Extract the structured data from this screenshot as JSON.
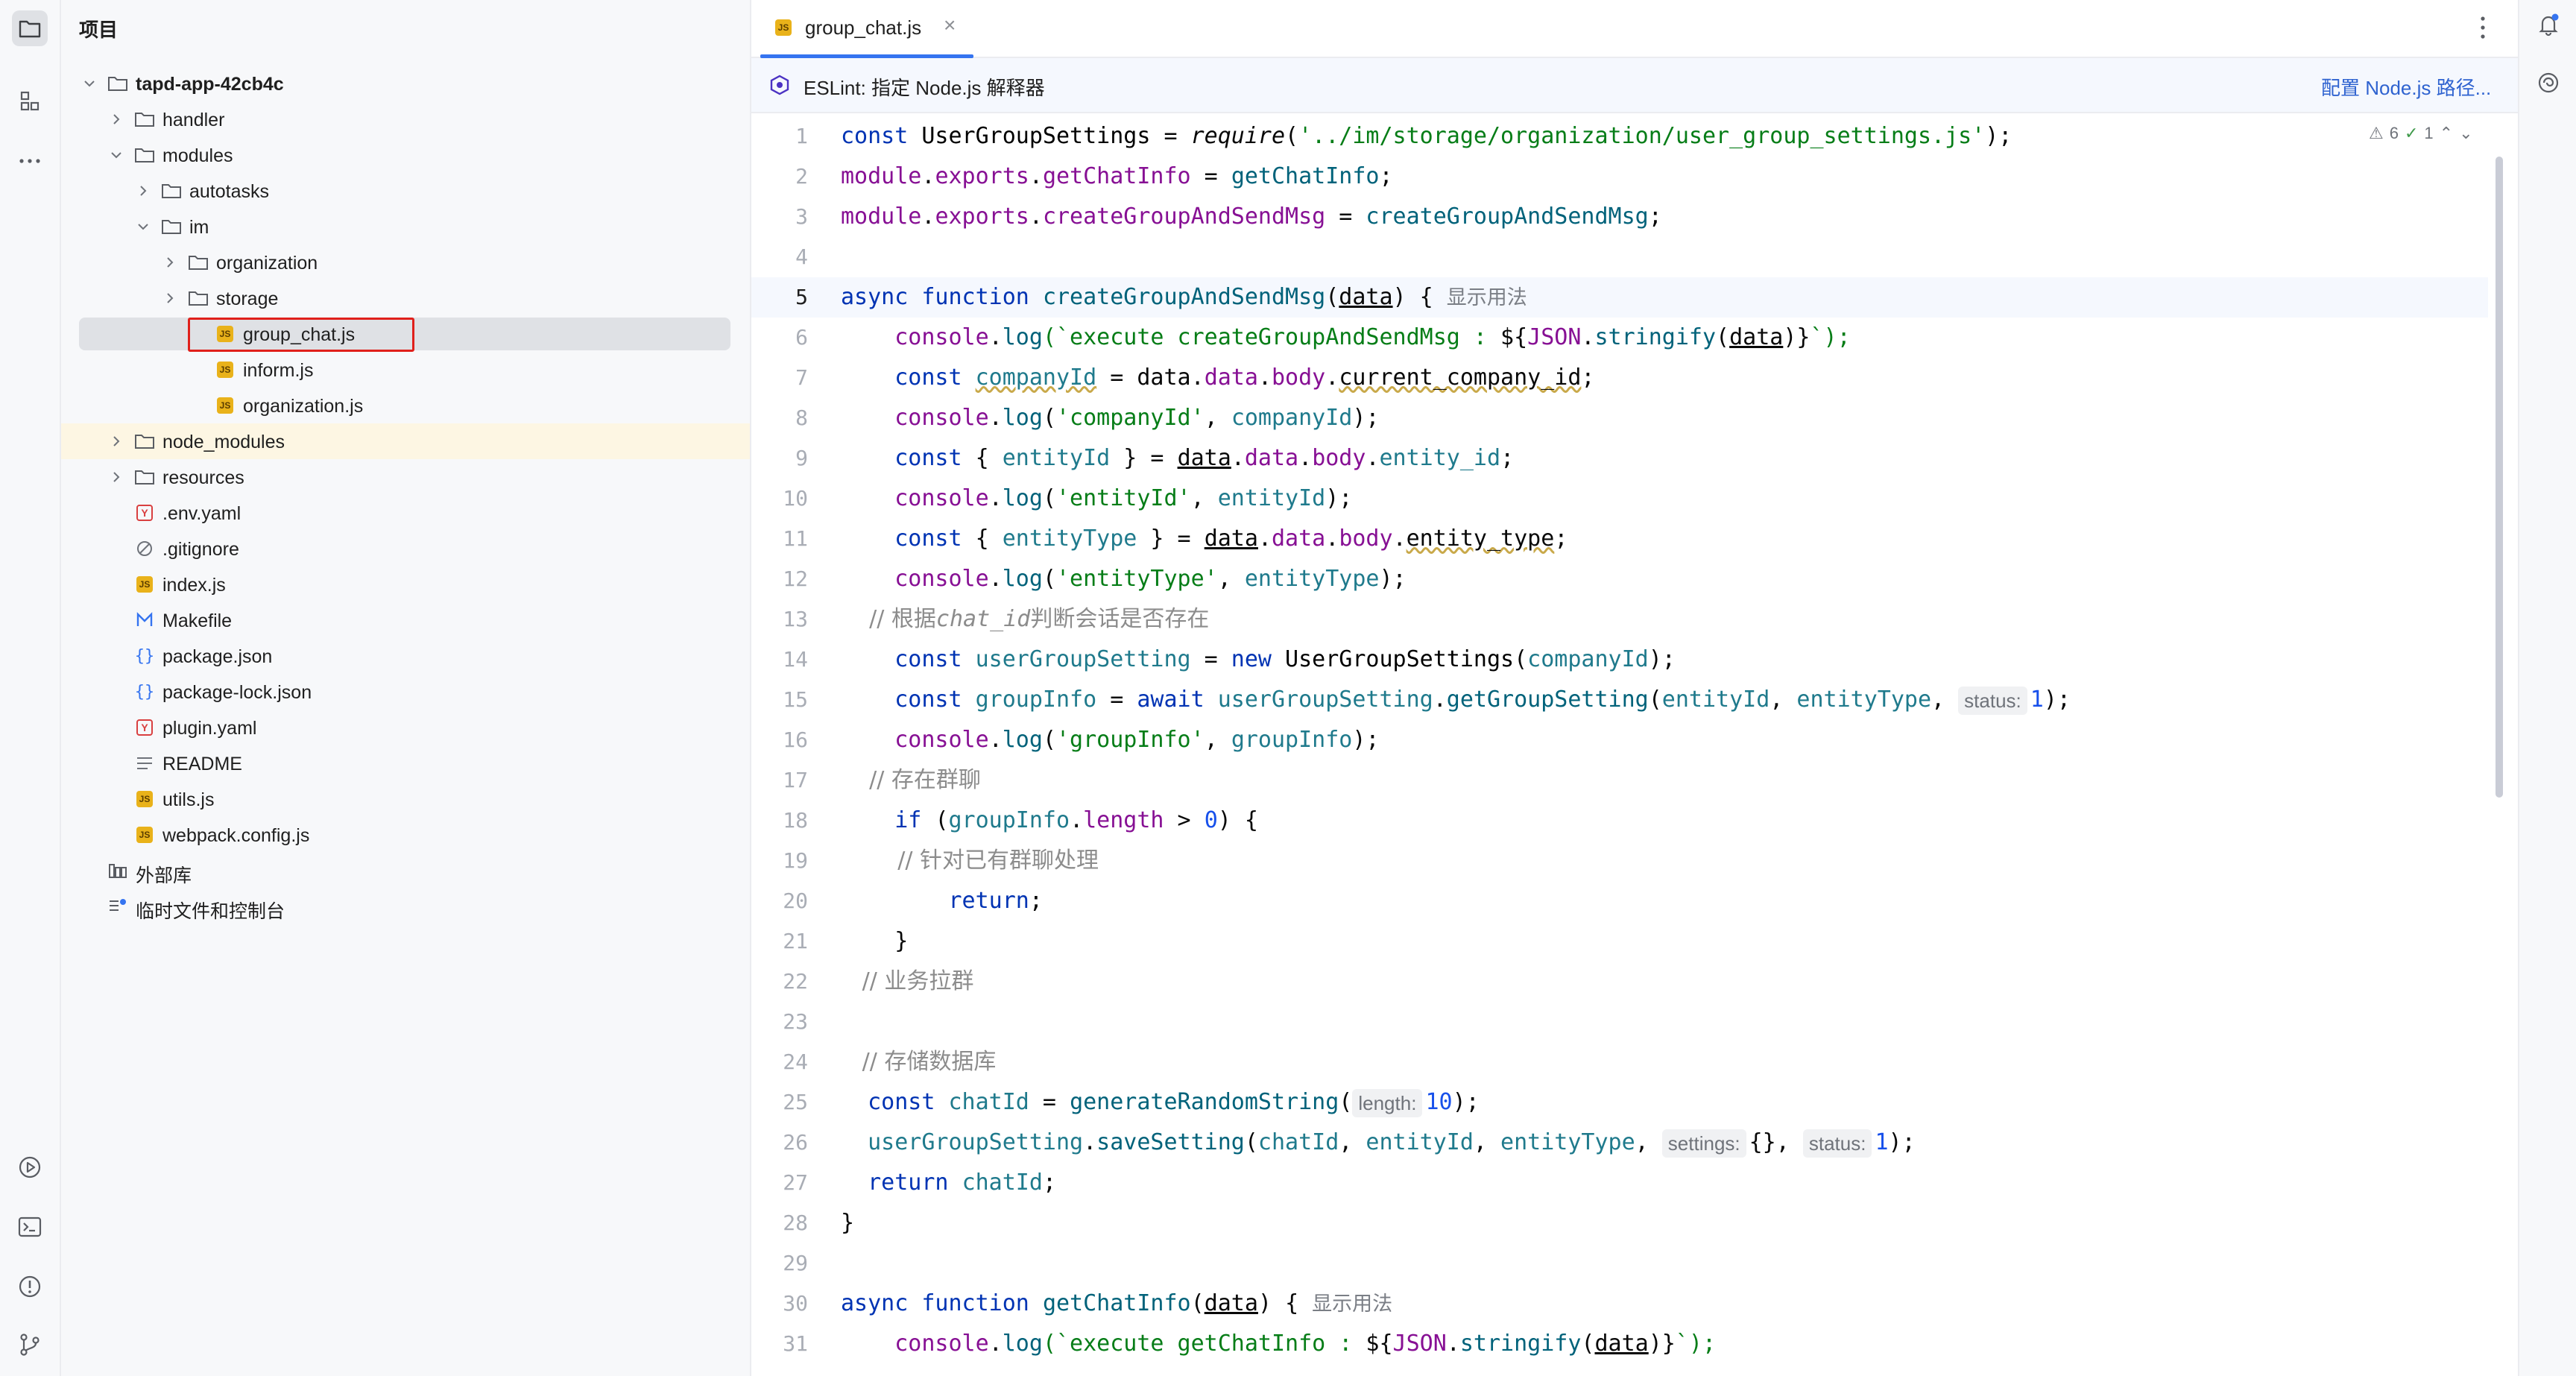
{
  "colors": {
    "accent": "#3574f0",
    "js_icon": "#e9b21a",
    "highlight_box": "#e0201b"
  },
  "toolstrip": {
    "top_icons": [
      "folder-icon",
      "structure-icon",
      "more-icon"
    ],
    "bottom_icons": [
      "run-icon",
      "terminal-icon",
      "problems-icon",
      "git-icon"
    ]
  },
  "project": {
    "title": "项目",
    "tree": [
      {
        "label": "tapd-app-42cb4c",
        "type": "folder",
        "expanded": true
      },
      {
        "label": "handler",
        "type": "folder",
        "expanded": false
      },
      {
        "label": "modules",
        "type": "folder",
        "expanded": true
      },
      {
        "label": "autotasks",
        "type": "folder",
        "expanded": false
      },
      {
        "label": "im",
        "type": "folder",
        "expanded": true
      },
      {
        "label": "organization",
        "type": "folder",
        "expanded": false
      },
      {
        "label": "storage",
        "type": "folder",
        "expanded": false
      },
      {
        "label": "group_chat.js",
        "type": "js",
        "selected": true
      },
      {
        "label": "inform.js",
        "type": "js"
      },
      {
        "label": "organization.js",
        "type": "js"
      },
      {
        "label": "node_modules",
        "type": "folder",
        "expanded": false
      },
      {
        "label": "resources",
        "type": "folder",
        "expanded": false
      },
      {
        "label": ".env.yaml",
        "type": "yaml"
      },
      {
        "label": ".gitignore",
        "type": "ignore"
      },
      {
        "label": "index.js",
        "type": "js"
      },
      {
        "label": "Makefile",
        "type": "makefile"
      },
      {
        "label": "package.json",
        "type": "json"
      },
      {
        "label": "package-lock.json",
        "type": "json"
      },
      {
        "label": "plugin.yaml",
        "type": "yaml"
      },
      {
        "label": "README",
        "type": "text"
      },
      {
        "label": "utils.js",
        "type": "js"
      },
      {
        "label": "webpack.config.js",
        "type": "js"
      },
      {
        "label": "外部库",
        "type": "library"
      },
      {
        "label": "临时文件和控制台",
        "type": "scratch"
      }
    ]
  },
  "editor": {
    "tab": {
      "label": "group_chat.js",
      "close": "×"
    },
    "banner": {
      "text": "ESLint: 指定 Node.js 解释器",
      "action": "配置 Node.js 路径..."
    },
    "inspections": {
      "warnings": "6",
      "weak_warnings": "1"
    },
    "usage_hint": "显示用法",
    "param_hints": {
      "status": "status:",
      "length": "length:",
      "settings": "settings:"
    },
    "line_numbers": [
      "1",
      "2",
      "3",
      "4",
      "5",
      "6",
      "7",
      "8",
      "9",
      "10",
      "11",
      "12",
      "13",
      "14",
      "15",
      "16",
      "17",
      "18",
      "19",
      "20",
      "21",
      "22",
      "23",
      "24",
      "25",
      "26",
      "27",
      "28",
      "29",
      "30",
      "31"
    ],
    "current_line": "5",
    "code": {
      "l1_a": "const ",
      "l1_b": "UserGroupSettings",
      "l1_c": " = ",
      "l1_d": "require",
      "l1_e": "(",
      "l1_f": "'../im/storage/organization/user_group_settings.js'",
      "l1_g": ");",
      "l2_a": "module",
      "l2_b": ".",
      "l2_c": "exports",
      "l2_d": ".",
      "l2_e": "getChatInfo",
      "l2_f": " = ",
      "l2_g": "getChatInfo",
      "l2_h": ";",
      "l3_a": "module",
      "l3_b": ".",
      "l3_c": "exports",
      "l3_d": ".",
      "l3_e": "createGroupAndSendMsg",
      "l3_f": " = ",
      "l3_g": "createGroupAndSendMsg",
      "l3_h": ";",
      "l5_a": "async function ",
      "l5_b": "createGroupAndSendMsg",
      "l5_c": "(",
      "l5_d": "data",
      "l5_e": ") ",
      "l5_f": "{",
      "l6_a": "    console",
      "l6_b": ".",
      "l6_c": "log",
      "l6_d": "(`execute createGroupAndSendMsg : ",
      "l6_e": "${",
      "l6_f": "JSON",
      "l6_g": ".",
      "l6_h": "stringify",
      "l6_i": "(",
      "l6_j": "data",
      "l6_k": ")",
      "l6_l": "}",
      "l6_m": "`);",
      "l7_a": "    const ",
      "l7_b": "companyId",
      "l7_c": " = ",
      "l7_d": "data",
      "l7_e": ".",
      "l7_f": "data",
      "l7_g": ".",
      "l7_h": "body",
      "l7_i": ".",
      "l7_j": "current_company_id",
      "l7_k": ";",
      "l8_a": "    console",
      "l8_b": ".",
      "l8_c": "log",
      "l8_d": "(",
      "l8_e": "'companyId'",
      "l8_f": ", ",
      "l8_g": "companyId",
      "l8_h": ");",
      "l9_a": "    const ",
      "l9_b": "{ ",
      "l9_c": "entityId",
      "l9_d": " } = ",
      "l9_e": "data",
      "l9_f": ".",
      "l9_g": "data",
      "l9_h": ".",
      "l9_i": "body",
      "l9_j": ".",
      "l9_k": "entity_id",
      "l9_l": ";",
      "l10_a": "    console",
      "l10_b": ".",
      "l10_c": "log",
      "l10_d": "(",
      "l10_e": "'entityId'",
      "l10_f": ", ",
      "l10_g": "entityId",
      "l10_h": ");",
      "l11_a": "    const ",
      "l11_b": "{ ",
      "l11_c": "entityType",
      "l11_d": " } = ",
      "l11_e": "data",
      "l11_f": ".",
      "l11_g": "data",
      "l11_h": ".",
      "l11_i": "body",
      "l11_j": ".",
      "l11_k": "entity_type",
      "l11_l": ";",
      "l12_a": "    console",
      "l12_b": ".",
      "l12_c": "log",
      "l12_d": "(",
      "l12_e": "'entityType'",
      "l12_f": ", ",
      "l12_g": "entityType",
      "l12_h": ");",
      "l13_a": "    // 根据",
      "l13_b": "chat_id",
      "l13_c": "判断会话是否存在",
      "l14_a": "    const ",
      "l14_b": "userGroupSetting",
      "l14_c": " = ",
      "l14_d": "new ",
      "l14_e": "UserGroupSettings",
      "l14_f": "(",
      "l14_g": "companyId",
      "l14_h": ");",
      "l15_a": "    const ",
      "l15_b": "groupInfo",
      "l15_c": " = ",
      "l15_d": "await ",
      "l15_e": "userGroupSetting",
      "l15_f": ".",
      "l15_g": "getGroupSetting",
      "l15_h": "(",
      "l15_i": "entityId",
      "l15_j": ", ",
      "l15_k": "entityType",
      "l15_l": ", ",
      "l15_m": "1",
      "l15_n": ");",
      "l16_a": "    console",
      "l16_b": ".",
      "l16_c": "log",
      "l16_d": "(",
      "l16_e": "'groupInfo'",
      "l16_f": ", ",
      "l16_g": "groupInfo",
      "l16_h": ");",
      "l17_a": "    // 存在群聊",
      "l18_a": "    if ",
      "l18_b": "(",
      "l18_c": "groupInfo",
      "l18_d": ".",
      "l18_e": "length",
      "l18_f": " > ",
      "l18_g": "0",
      "l18_h": ") {",
      "l19_a": "        // 针对已有群聊处理",
      "l20_a": "        return",
      "l20_b": ";",
      "l21_a": "    }",
      "l22_a": "   // 业务拉群",
      "l24_a": "   // 存储数据库",
      "l25_a": "  const ",
      "l25_b": "chatId",
      "l25_c": " = ",
      "l25_d": "generateRandomString",
      "l25_e": "(",
      "l25_f": "10",
      "l25_g": ");",
      "l26_a": "  userGroupSetting",
      "l26_b": ".",
      "l26_c": "saveSetting",
      "l26_d": "(",
      "l26_e": "chatId",
      "l26_f": ", ",
      "l26_g": "entityId",
      "l26_h": ", ",
      "l26_i": "entityType",
      "l26_j": ", ",
      "l26_k": "{}",
      "l26_l": ", ",
      "l26_m": "1",
      "l26_n": ");",
      "l27_a": "  return ",
      "l27_b": "chatId",
      "l27_c": ";",
      "l28_a": "}",
      "l30_a": "async function ",
      "l30_b": "getChatInfo",
      "l30_c": "(",
      "l30_d": "data",
      "l30_e": ") ",
      "l30_f": "{",
      "l31_a": "    console",
      "l31_b": ".",
      "l31_c": "log",
      "l31_d": "(`execute getChatInfo : ",
      "l31_e": "${",
      "l31_f": "JSON",
      "l31_g": ".",
      "l31_h": "stringify",
      "l31_i": "(",
      "l31_j": "data",
      "l31_k": ")",
      "l31_l": "}",
      "l31_m": "`);"
    }
  },
  "rightstrip": {
    "icons": [
      "notifications-icon",
      "ai-assistant-icon"
    ]
  }
}
